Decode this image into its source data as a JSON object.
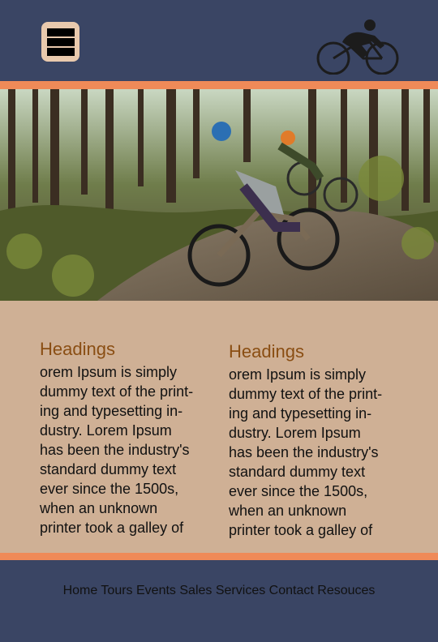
{
  "header": {
    "menu_icon": "hamburger-menu-icon",
    "logo_icon": "cyclist-bicycle-icon"
  },
  "hero": {
    "image": "mountain-bikers-forest-trail-photo"
  },
  "content": {
    "columns": [
      {
        "heading": "Headings",
        "text": " orem Ipsum is simply\ndummy text of the print-\ning and typesetting in-\ndustry. Lorem Ipsum\nhas been the industry's\nstandard dummy text\never since the 1500s,\nwhen an unknown\nprinter took a galley of"
      },
      {
        "heading": "Headings",
        "text": " orem Ipsum is simply\ndummy text of the print-\ning and typesetting in-\ndustry. Lorem Ipsum\nhas been the industry's\nstandard dummy text\never since the 1500s,\nwhen an unknown\nprinter took a galley of"
      }
    ]
  },
  "footer": {
    "nav": [
      {
        "label": "Home"
      },
      {
        "label": "Tours"
      },
      {
        "label": "Events"
      },
      {
        "label": "Sales"
      },
      {
        "label": "Services"
      },
      {
        "label": "Contact"
      },
      {
        "label": "Resouces"
      }
    ]
  },
  "colors": {
    "navy": "#3a4564",
    "accent_orange": "#ef8a58",
    "content_tan": "#cfb095",
    "heading_brown": "#8a4e13",
    "menu_button": "#e9c9ad"
  }
}
